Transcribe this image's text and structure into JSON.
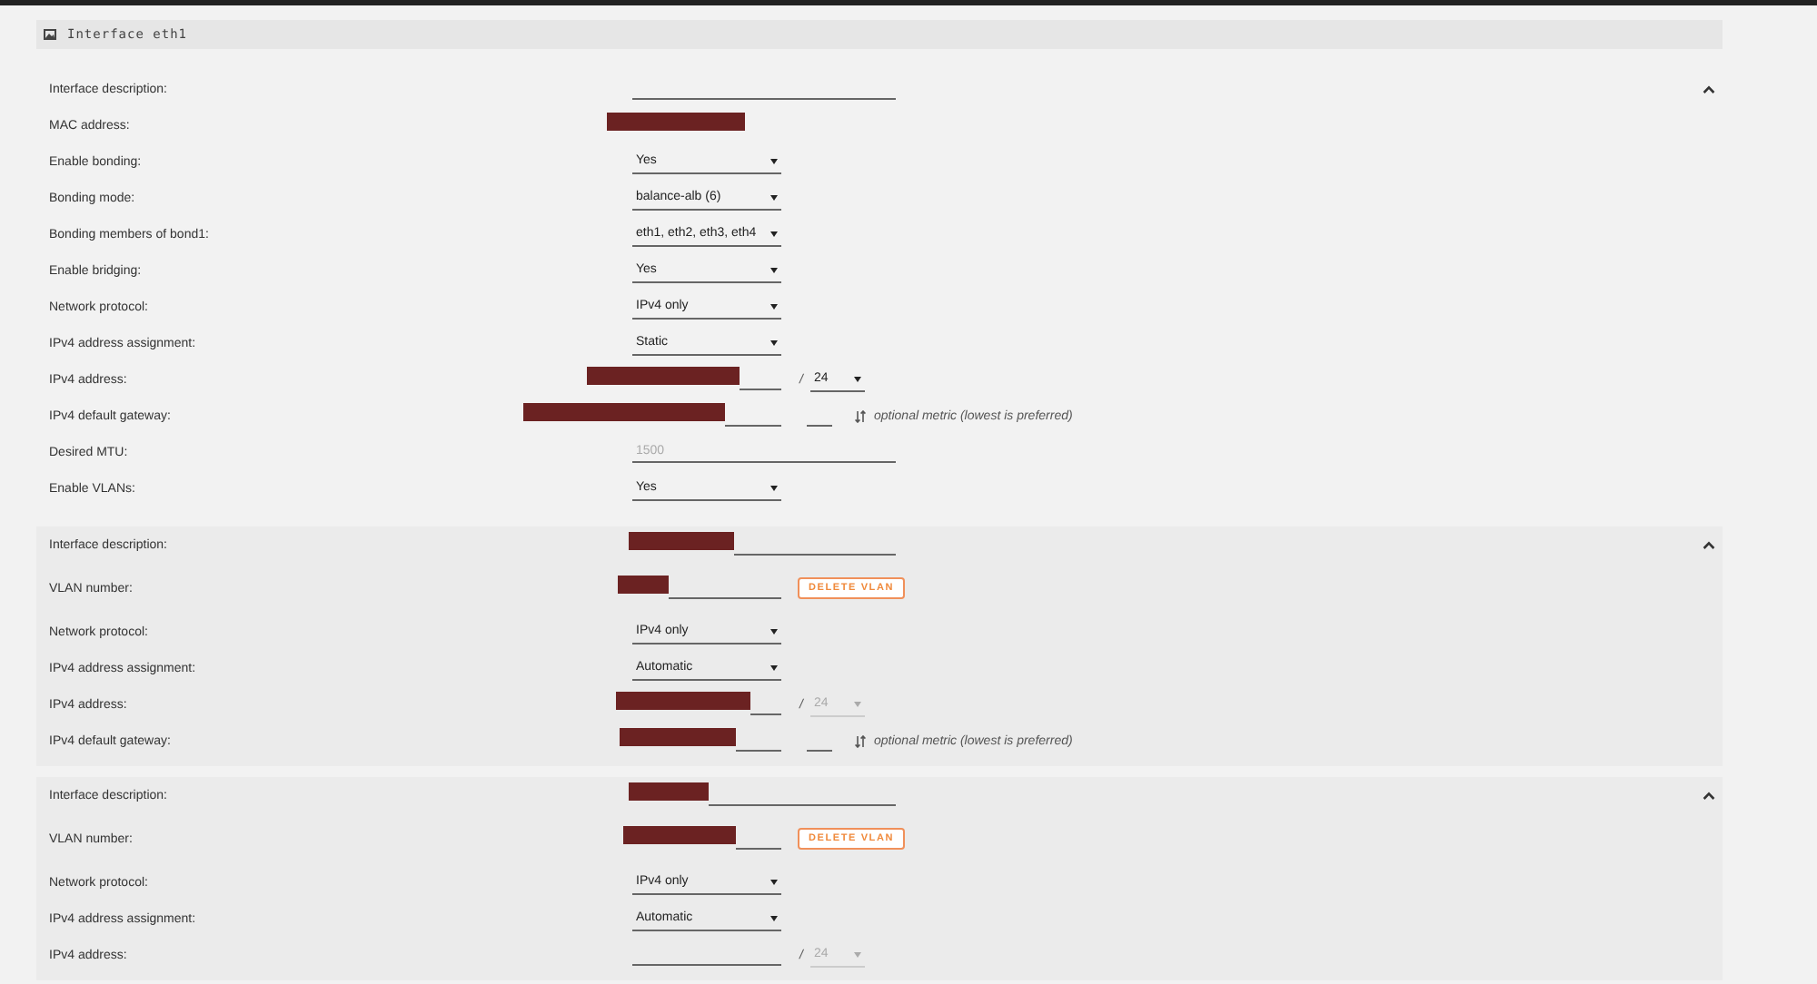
{
  "panel": {
    "title": "Interface eth1"
  },
  "sections": [
    {
      "expanded": true,
      "rows": [
        {
          "label": "Interface description:",
          "kind": "text"
        },
        {
          "label": "MAC address:",
          "kind": "static",
          "redacted": true
        },
        {
          "label": "Enable bonding:",
          "kind": "select",
          "value": "Yes"
        },
        {
          "label": "Bonding mode:",
          "kind": "select",
          "value": "balance-alb (6)"
        },
        {
          "label": "Bonding members of bond1:",
          "kind": "select",
          "value": "eth1, eth2, eth3, eth4"
        },
        {
          "label": "Enable bridging:",
          "kind": "select",
          "value": "Yes"
        },
        {
          "label": "Network protocol:",
          "kind": "select",
          "value": "IPv4 only"
        },
        {
          "label": "IPv4 address assignment:",
          "kind": "select",
          "value": "Static"
        },
        {
          "label": "IPv4 address:",
          "kind": "ipv4",
          "redacted": true,
          "separator": "/",
          "prefix": "24",
          "disabled": false
        },
        {
          "label": "IPv4 default gateway:",
          "kind": "gateway",
          "redacted": true,
          "note": "optional metric (lowest is preferred)"
        },
        {
          "label": "Desired MTU:",
          "kind": "text",
          "placeholder": "1500"
        },
        {
          "label": "Enable VLANs:",
          "kind": "select",
          "value": "Yes"
        }
      ]
    },
    {
      "expanded": true,
      "rows": [
        {
          "label": "Interface description:",
          "kind": "text",
          "redacted": true
        },
        {
          "label": "VLAN number:",
          "kind": "vlan",
          "redacted": true,
          "button": "DELETE VLAN"
        },
        {
          "label": "Network protocol:",
          "kind": "select",
          "value": "IPv4 only"
        },
        {
          "label": "IPv4 address assignment:",
          "kind": "select",
          "value": "Automatic"
        },
        {
          "label": "IPv4 address:",
          "kind": "ipv4",
          "redacted": true,
          "separator": "/",
          "prefix": "24",
          "disabled": true
        },
        {
          "label": "IPv4 default gateway:",
          "kind": "gateway",
          "redacted": true,
          "note": "optional metric (lowest is preferred)"
        }
      ]
    },
    {
      "expanded": true,
      "rows": [
        {
          "label": "Interface description:",
          "kind": "text",
          "redacted": true
        },
        {
          "label": "VLAN number:",
          "kind": "vlan",
          "redacted": true,
          "button": "DELETE VLAN"
        },
        {
          "label": "Network protocol:",
          "kind": "select",
          "value": "IPv4 only"
        },
        {
          "label": "IPv4 address assignment:",
          "kind": "select",
          "value": "Automatic"
        },
        {
          "label": "IPv4 address:",
          "kind": "ipv4",
          "separator": "/",
          "prefix": "24",
          "disabled": true
        }
      ]
    }
  ]
}
